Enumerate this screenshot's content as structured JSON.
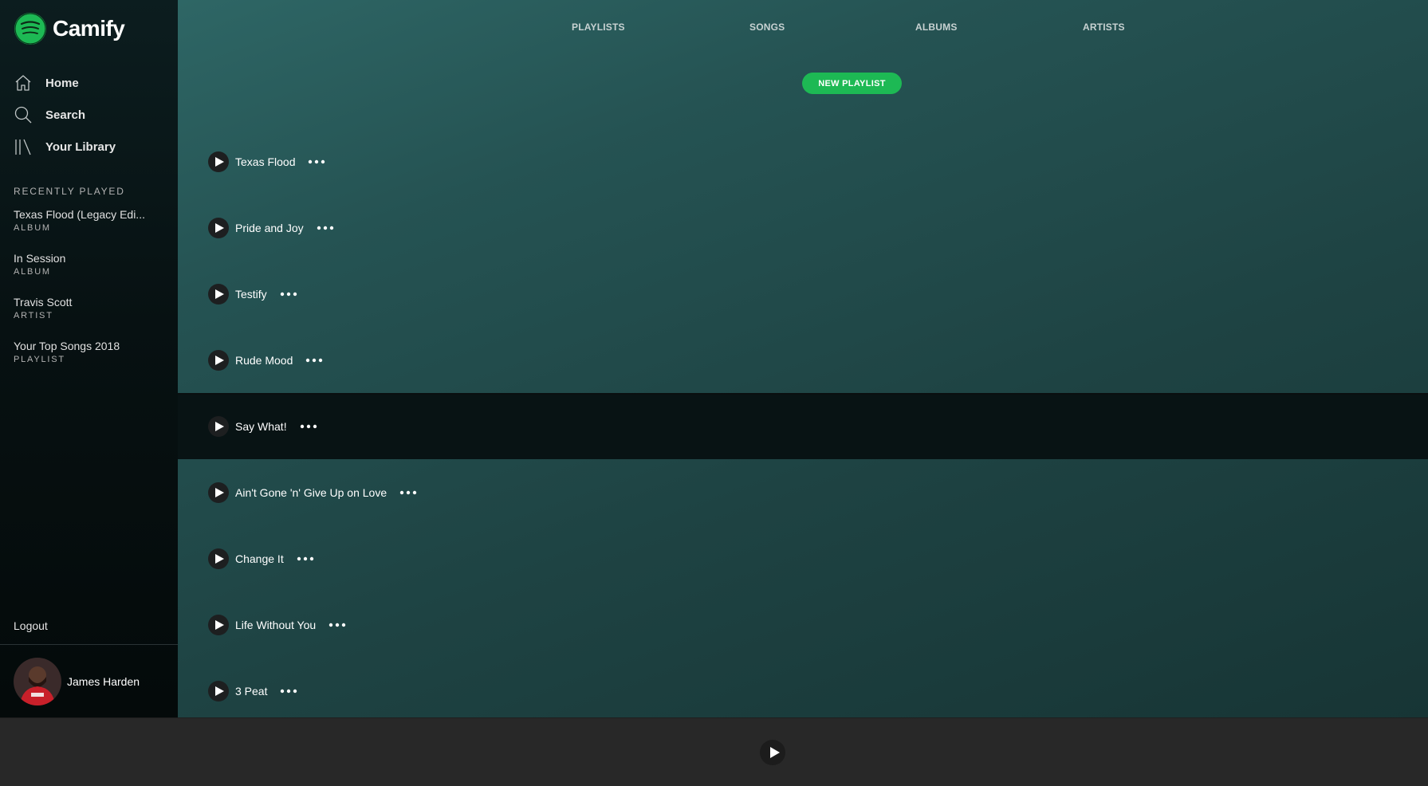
{
  "app": {
    "name": "Camify",
    "brand_color": "#1db954"
  },
  "nav": [
    {
      "label": "Home",
      "icon": "home-icon"
    },
    {
      "label": "Search",
      "icon": "search-icon"
    },
    {
      "label": "Your Library",
      "icon": "library-icon"
    }
  ],
  "recently_played": {
    "title": "RECENTLY PLAYED",
    "items": [
      {
        "name": "Texas Flood (Legacy Edi...",
        "type": "ALBUM"
      },
      {
        "name": "In Session",
        "type": "ALBUM"
      },
      {
        "name": "Travis Scott",
        "type": "ARTIST"
      },
      {
        "name": "Your Top Songs 2018",
        "type": "PLAYLIST"
      }
    ]
  },
  "logout_label": "Logout",
  "user": {
    "name": "James Harden"
  },
  "tabs": [
    "PLAYLISTS",
    "SONGS",
    "ALBUMS",
    "ARTISTS"
  ],
  "new_playlist_label": "NEW PLAYLIST",
  "tracks": [
    {
      "name": "Texas Flood"
    },
    {
      "name": "Pride and Joy"
    },
    {
      "name": "Testify"
    },
    {
      "name": "Rude Mood"
    },
    {
      "name": "Say What!"
    },
    {
      "name": "Ain't Gone 'n' Give Up on Love"
    },
    {
      "name": "Change It"
    },
    {
      "name": "Life Without You"
    },
    {
      "name": "3 Peat"
    }
  ],
  "active_track_index": 4
}
